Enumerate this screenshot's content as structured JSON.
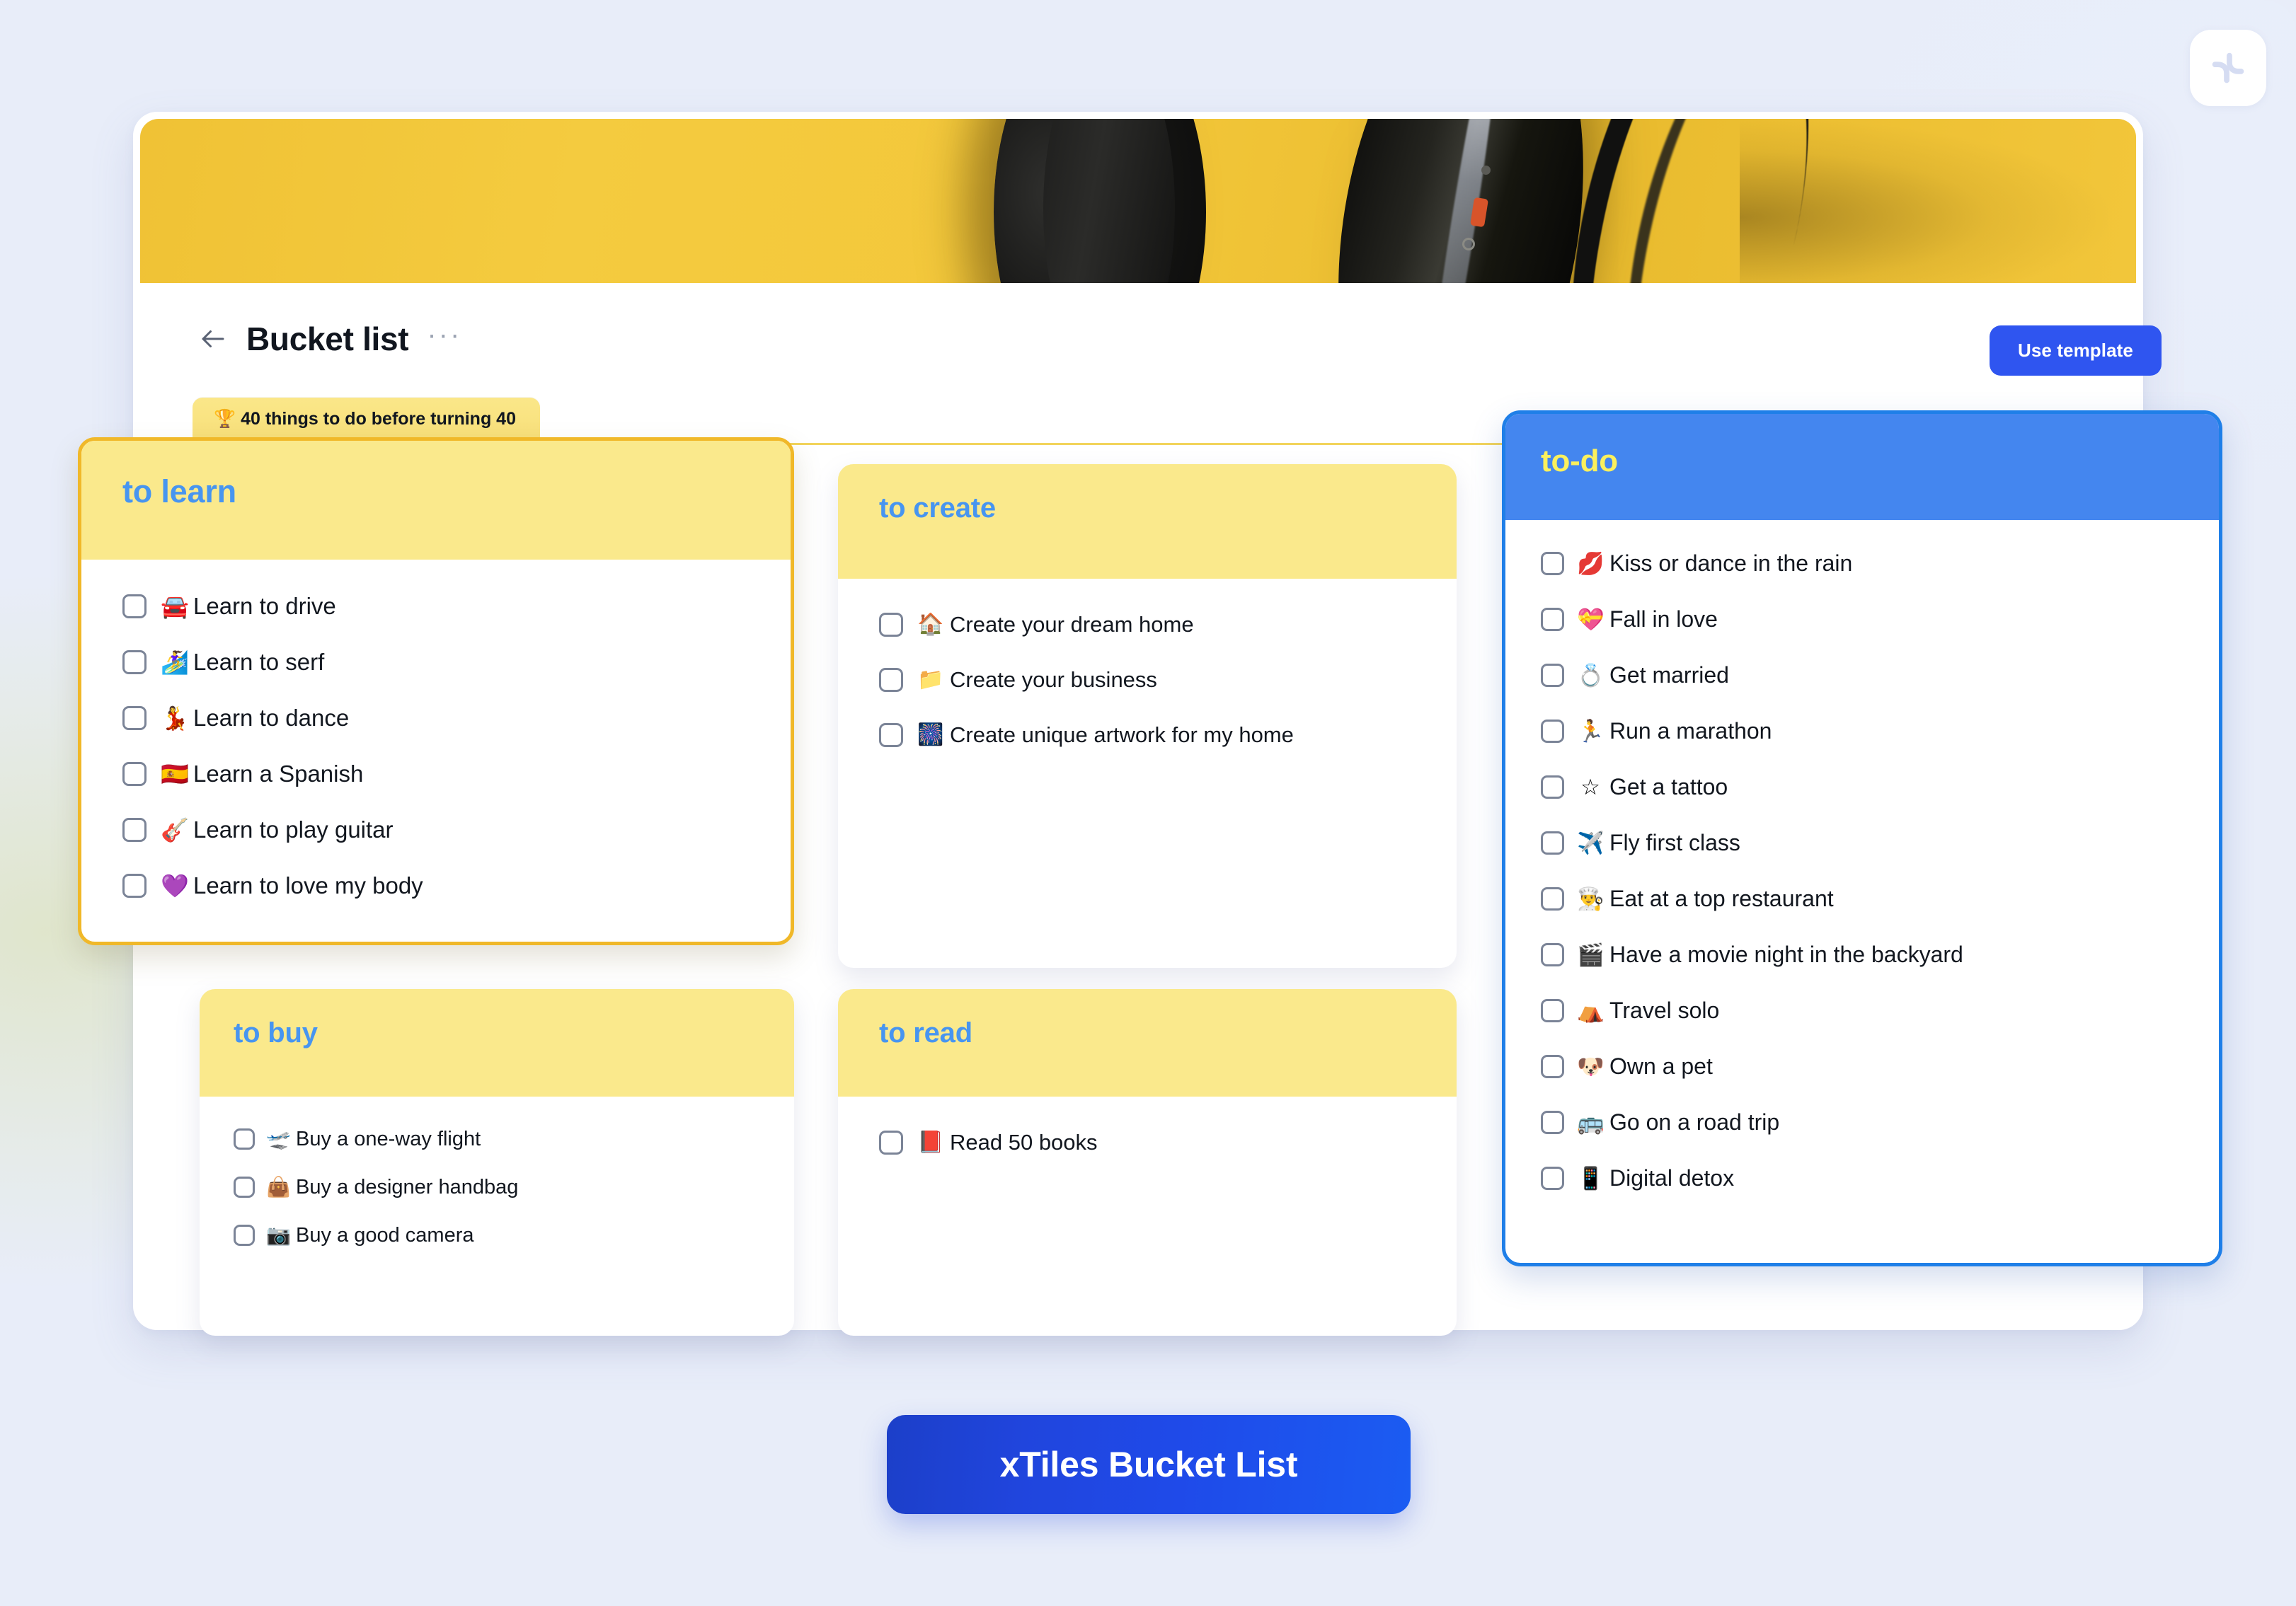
{
  "brand": {
    "logo_icon": "xtiles-logo-icon"
  },
  "header": {
    "back_icon": "back-arrow-icon",
    "title": "Bucket list",
    "more_label": "···",
    "use_template_label": "Use template"
  },
  "tab": {
    "label": "🏆 40 things to do before turning 40"
  },
  "cards": [
    {
      "id": "to-learn",
      "title": "to learn",
      "items": [
        {
          "emoji": "🚘",
          "text": "Learn to drive",
          "checked": false
        },
        {
          "emoji": "🏄‍♀️",
          "text": "Learn to serf",
          "checked": false
        },
        {
          "emoji": "💃",
          "text": "Learn to dance",
          "checked": false
        },
        {
          "emoji": "🇪🇸",
          "text": "Learn a Spanish",
          "checked": false
        },
        {
          "emoji": "🎸",
          "text": "Learn to play guitar",
          "checked": false
        },
        {
          "emoji": "💜",
          "text": "Learn to love my body",
          "checked": false
        }
      ]
    },
    {
      "id": "to-create",
      "title": "to create",
      "items": [
        {
          "emoji": "🏠",
          "text": "Create your dream home",
          "checked": false
        },
        {
          "emoji": "📁",
          "text": "Create your business",
          "checked": false
        },
        {
          "emoji": "🎆",
          "text": "Create unique artwork for my home",
          "checked": false
        }
      ]
    },
    {
      "id": "to-buy",
      "title": "to buy",
      "items": [
        {
          "emoji": "🛫",
          "text": "Buy a one-way flight",
          "checked": false
        },
        {
          "emoji": "👜",
          "text": "Buy a designer handbag",
          "checked": false
        },
        {
          "emoji": "📷",
          "text": "Buy a good camera",
          "checked": false
        }
      ]
    },
    {
      "id": "to-read",
      "title": "to read",
      "items": [
        {
          "emoji": "📕",
          "text": "Read 50 books",
          "checked": false
        }
      ]
    },
    {
      "id": "todo",
      "title": "to-do",
      "items": [
        {
          "emoji": "💋",
          "text": "Kiss or dance in the rain",
          "checked": false
        },
        {
          "emoji": "💝",
          "text": "Fall in love",
          "checked": false
        },
        {
          "emoji": "💍",
          "text": "Get married",
          "checked": false
        },
        {
          "emoji": "🏃",
          "text": "Run a marathon",
          "checked": false
        },
        {
          "emoji": "☆",
          "text": "Get a tattoo",
          "checked": false
        },
        {
          "emoji": "✈️",
          "text": "Fly first class",
          "checked": false
        },
        {
          "emoji": "👨‍🍳",
          "text": "Eat at a top restaurant",
          "checked": false
        },
        {
          "emoji": "🎬",
          "text": "Have a movie night in the backyard",
          "checked": false
        },
        {
          "emoji": "⛺",
          "text": "Travel solo",
          "checked": false
        },
        {
          "emoji": "🐶",
          "text": "Own a pet",
          "checked": false
        },
        {
          "emoji": "🚌",
          "text": "Go on a road trip",
          "checked": false
        },
        {
          "emoji": "📱",
          "text": "Digital detox",
          "checked": false
        }
      ]
    }
  ],
  "cta": {
    "label": "xTiles Bucket List"
  },
  "colors": {
    "accent_blue": "#2f55f0",
    "card_yellow": "#fae98c",
    "card_title_blue": "#4795f0",
    "todo_header_blue": "#4486ef",
    "todo_title_yellow": "#fbf05c",
    "gold_border": "#f0b829",
    "banner_yellow": "#f3c73a",
    "page_bg": "#e8edf9"
  }
}
